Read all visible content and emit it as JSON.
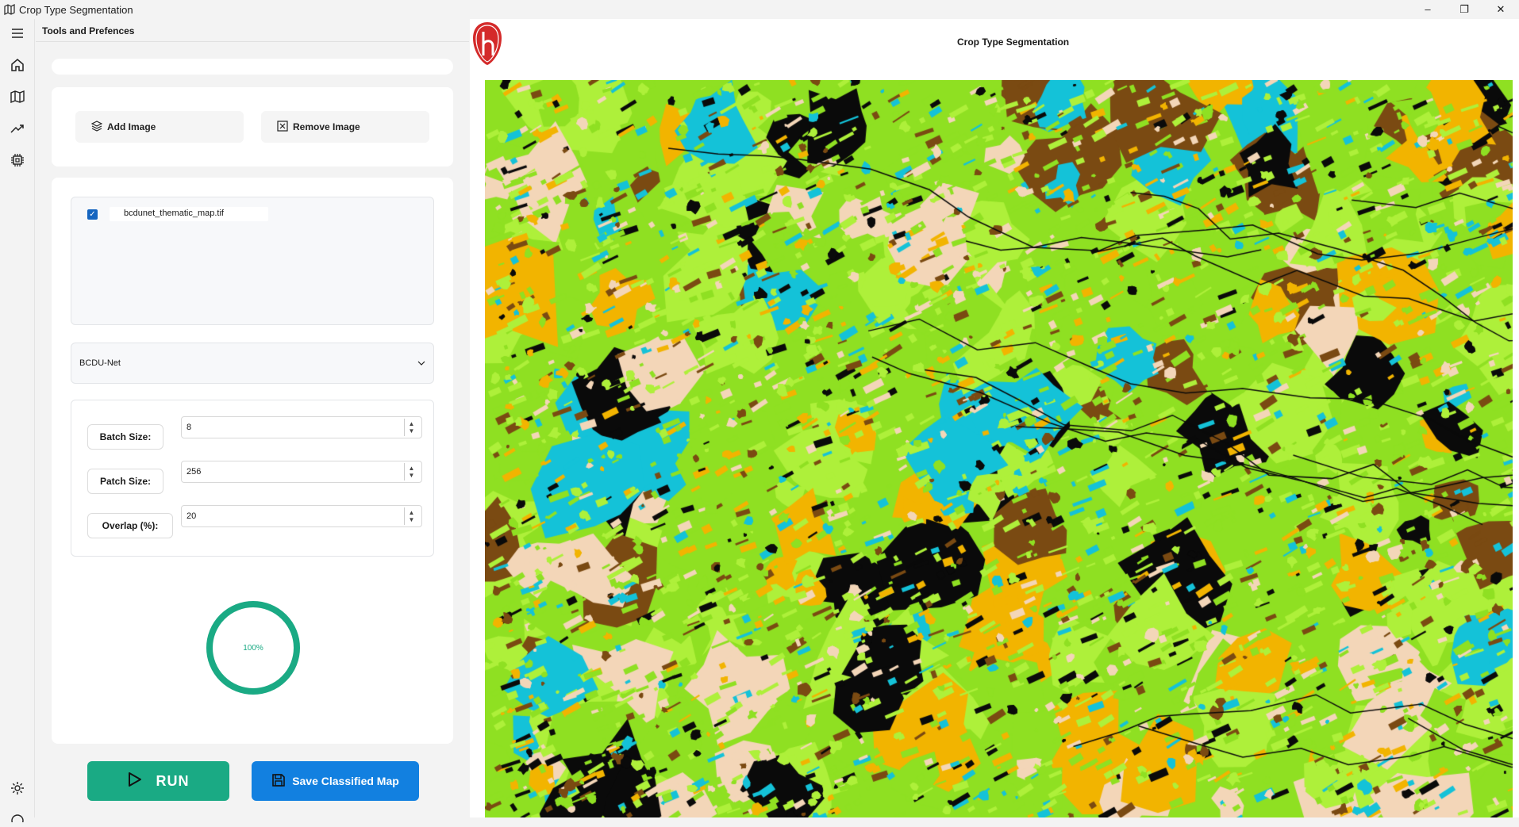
{
  "window": {
    "title": "Crop Type Segmentation",
    "controls": [
      "–",
      "❐",
      "✕"
    ]
  },
  "left_panel": {
    "title": "Tools and Prefences",
    "add_image_label": "Add Image",
    "remove_image_label": "Remove Image",
    "layers": [
      {
        "name": "bcdunet_thematic_map.tif",
        "checked": true
      }
    ],
    "model_select": {
      "selected": "BCDU-Net"
    },
    "params": {
      "batch_size_label": "Batch Size:",
      "batch_size_value": "8",
      "patch_size_label": "Patch Size:",
      "patch_size_value": "256",
      "overlap_label": "Overlap (%):",
      "overlap_value": "20"
    },
    "progress": {
      "text": "100%",
      "value": 1.0
    },
    "run_label": "RUN",
    "save_label": "Save Classified Map"
  },
  "right_panel": {
    "title": "Crop Type Segmentation"
  },
  "map_palette": {
    "green": "#8fe022",
    "light_green": "#aef03a",
    "cyan": "#14c2d8",
    "brown": "#7a4a12",
    "yellow": "#f2b400",
    "black": "#0a0a0a",
    "peach": "#f3d6b8"
  },
  "colors": {
    "run": "#1aaa84",
    "save": "#1280e0",
    "progress_ring": "#1aaa84",
    "logo": "#d42a2a"
  }
}
